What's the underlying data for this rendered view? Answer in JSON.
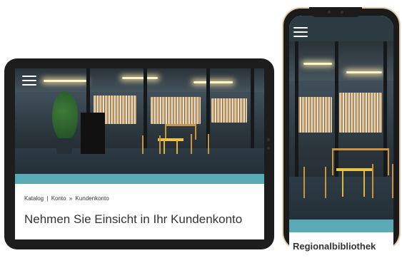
{
  "tablet": {
    "menu_icon": "hamburger-menu-icon",
    "breadcrumb": [
      {
        "label": "Katalog"
      },
      {
        "separator": "|"
      },
      {
        "label": "Konto"
      },
      {
        "separator": "»"
      },
      {
        "label": "Kundenkonto"
      }
    ],
    "page_title": "Nehmen Sie Einsicht in Ihr Kundenkonto"
  },
  "phone": {
    "menu_icon": "hamburger-menu-icon",
    "page_title": "Regionalbibliothek"
  },
  "colors": {
    "accent_teal": "#5aa9b4",
    "device_frame": "#1d1d1d",
    "phone_bezel_gold": "#e8c9a8",
    "title_text": "#333333"
  }
}
